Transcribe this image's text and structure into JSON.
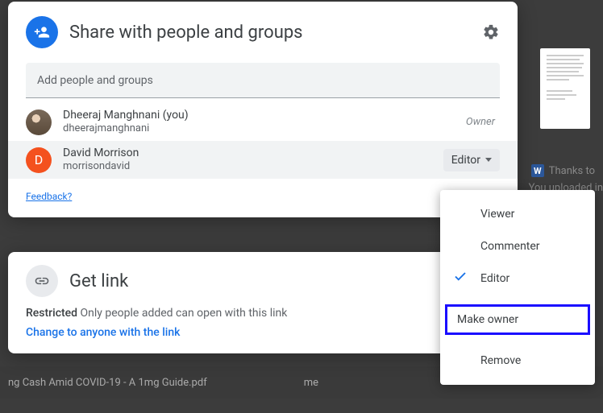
{
  "share": {
    "title": "Share with people and groups",
    "add_placeholder": "Add people and groups",
    "feedback": "Feedback?"
  },
  "people": [
    {
      "name": "Dheeraj Manghnani (you)",
      "email": "dheerajmanghnani",
      "role": "Owner",
      "initial": ""
    },
    {
      "name": "David Morrison",
      "email": "morrisondavid",
      "role": "Editor",
      "initial": "D"
    }
  ],
  "link": {
    "title": "Get link",
    "restriction_label": "Restricted",
    "restriction_text": " Only people added can open with this link",
    "change": "Change to anyone with the link"
  },
  "menu": {
    "viewer": "Viewer",
    "commenter": "Commenter",
    "editor": "Editor",
    "make_owner": "Make owner",
    "remove": "Remove"
  },
  "background": {
    "filename": "ng Cash Amid COVID-19 - A 1mg Guide.pdf",
    "file_owner": "me",
    "side1": "Thanks to",
    "side2": "You uploaded in"
  }
}
